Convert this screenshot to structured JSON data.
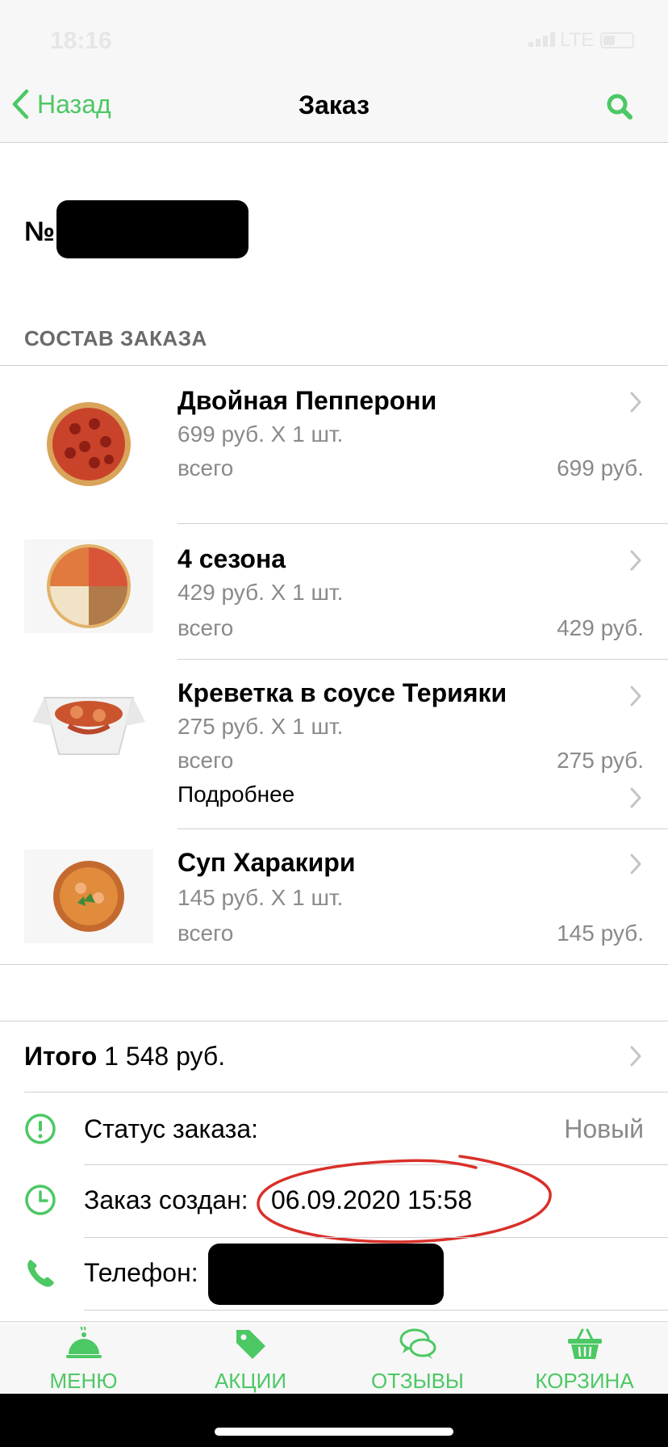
{
  "status_bar": {
    "time": "18:16",
    "network": "LTE"
  },
  "nav": {
    "back_label": "Назад",
    "title": "Заказ"
  },
  "order": {
    "number_prefix": "№"
  },
  "section_title": "СОСТАВ ЗАКАЗА",
  "items": [
    {
      "name": "Двойная Пепперони",
      "price_line": "699 руб. X 1 шт.",
      "total_label": "всего",
      "total_value": "699 руб."
    },
    {
      "name": "4 сезона",
      "price_line": "429 руб. X 1 шт.",
      "total_label": "всего",
      "total_value": "429 руб."
    },
    {
      "name": "Креветка в соусе Терияки",
      "price_line": "275 руб. X 1 шт.",
      "total_label": "всего",
      "total_value": "275 руб.",
      "more_label": "Подробнее"
    },
    {
      "name": "Суп Харакири",
      "price_line": "145 руб. X 1 шт.",
      "total_label": "всего",
      "total_value": "145 руб."
    }
  ],
  "summary": {
    "total_label": "Итого",
    "total_value": "1 548 руб.",
    "status_label": "Статус заказа:",
    "status_value": "Новый",
    "created_label": "Заказ создан:",
    "created_value": "06.09.2020 15:58",
    "phone_label": "Телефон:"
  },
  "tabs": [
    {
      "label": "МЕНЮ",
      "icon": "cloche-icon"
    },
    {
      "label": "АКЦИИ",
      "icon": "tag-icon"
    },
    {
      "label": "ОТЗЫВЫ",
      "icon": "chat-icon"
    },
    {
      "label": "КОРЗИНА",
      "icon": "basket-icon"
    }
  ],
  "colors": {
    "accent": "#4cc864",
    "annotation": "#d9302a"
  }
}
